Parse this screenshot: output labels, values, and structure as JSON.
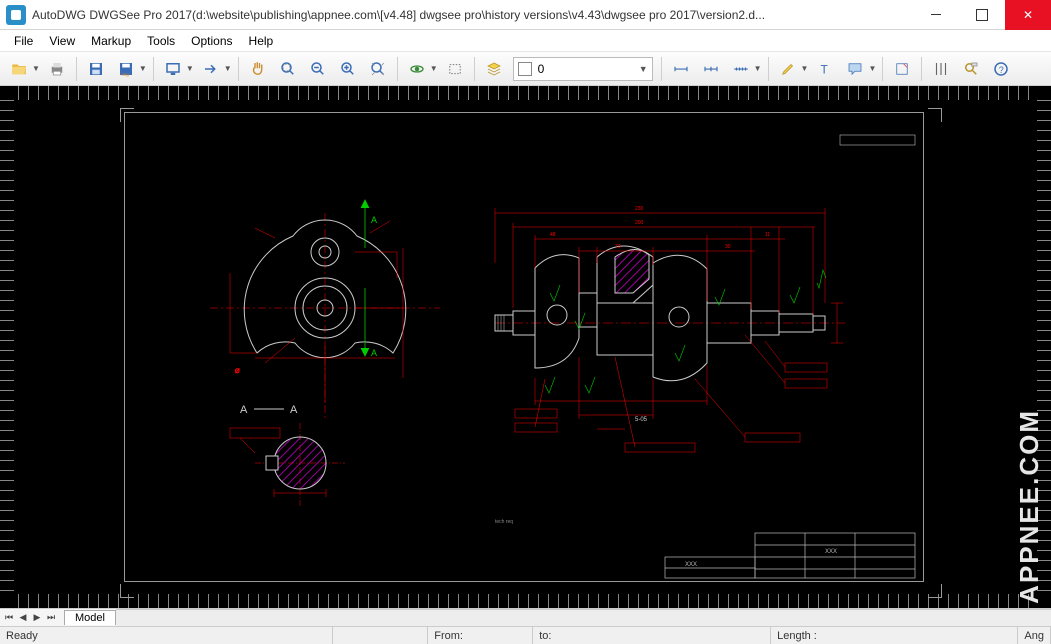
{
  "title": "AutoDWG DWGSee Pro 2017(d:\\website\\publishing\\appnee.com\\[v4.48] dwgsee pro\\history versions\\v4.43\\dwgsee pro 2017\\version2.d...",
  "menu": [
    "File",
    "View",
    "Markup",
    "Tools",
    "Options",
    "Help"
  ],
  "toolbar": {
    "layer_value": "0"
  },
  "tabs": {
    "model": "Model"
  },
  "status": {
    "ready": "Ready",
    "from": "From:",
    "to": "to:",
    "length": "Length :",
    "ang": "Ang"
  },
  "drawing": {
    "section_label_a1": "A",
    "section_label_a2": "A",
    "title_block": [
      "XXX",
      "XXX"
    ]
  },
  "watermark": "APPNEE.COM"
}
